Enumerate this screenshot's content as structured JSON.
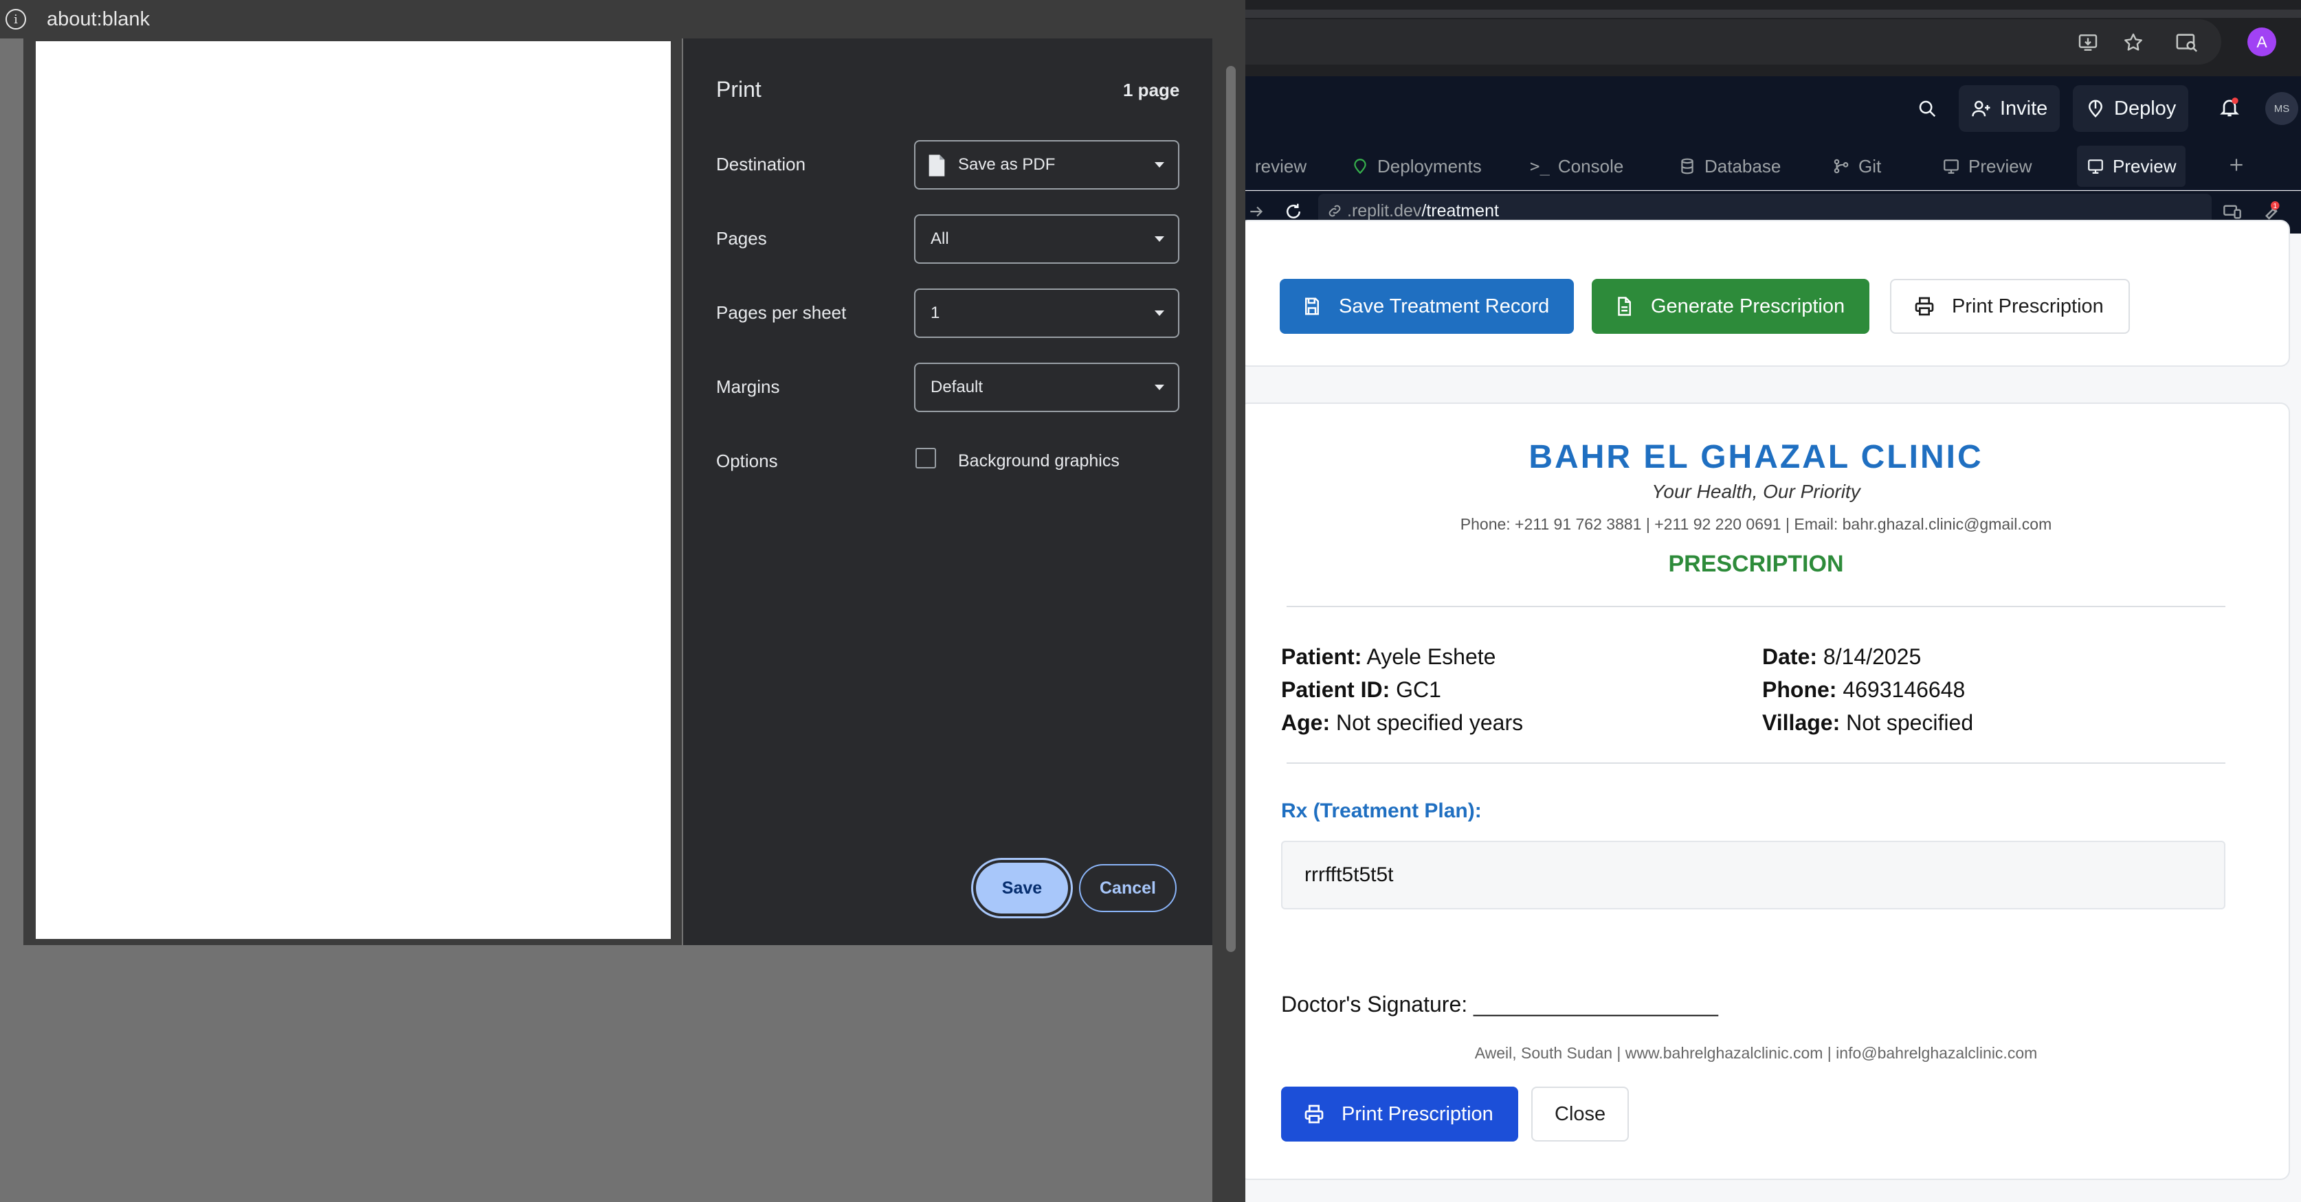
{
  "print_window": {
    "title": "about:blank",
    "heading": "Print",
    "page_count": "1 page",
    "destination_label": "Destination",
    "destination_value": "Save as PDF",
    "pages_label": "Pages",
    "pages_value": "All",
    "pages_per_sheet_label": "Pages per sheet",
    "pages_per_sheet_value": "1",
    "margins_label": "Margins",
    "margins_value": "Default",
    "options_label": "Options",
    "background_graphics_label": "Background graphics",
    "save_label": "Save",
    "cancel_label": "Cancel"
  },
  "replit": {
    "invite_label": "Invite",
    "deploy_label": "Deploy",
    "avatar_initials": "MS",
    "profile_initial": "A",
    "notification_count": "1",
    "tabs": [
      {
        "label": "review"
      },
      {
        "label": "Deployments"
      },
      {
        "label": "Console"
      },
      {
        "label": "Database"
      },
      {
        "label": "Git"
      },
      {
        "label": "Preview"
      },
      {
        "label": "Preview"
      }
    ],
    "url_prefix": ".replit.dev",
    "url_path": "/treatment"
  },
  "treatment": {
    "save_record_label": "Save Treatment Record",
    "generate_label": "Generate Prescription",
    "print_label": "Print Prescription"
  },
  "prescription": {
    "clinic_name": "BAHR EL GHAZAL CLINIC",
    "tagline": "Your Health, Our Priority",
    "contact": "Phone: +211 91 762 3881 | +211 92 220 0691 | Email: bahr.ghazal.clinic@gmail.com",
    "heading": "PRESCRIPTION",
    "patient_label": "Patient:",
    "patient_value": "Ayele Eshete",
    "patient_id_label": "Patient ID:",
    "patient_id_value": "GC1",
    "age_label": "Age:",
    "age_value": "Not specified years",
    "date_label": "Date:",
    "date_value": "8/14/2025",
    "phone_label": "Phone:",
    "phone_value": "4693146648",
    "village_label": "Village:",
    "village_value": "Not specified",
    "rx_label": "Rx (Treatment Plan):",
    "rx_text": "rrrfft5t5t5t",
    "signature_text": "Doctor's Signature: ____________________",
    "footer": "Aweil, South Sudan | www.bahrelghazalclinic.com | info@bahrelghazalclinic.com",
    "print_label": "Print Prescription",
    "close_label": "Close"
  },
  "colors": {
    "clinic_blue": "#1f6fc1",
    "prescription_green": "#2d8b3a",
    "print_button_blue": "#1c4fd8",
    "save_button": "#a8c7fa"
  }
}
